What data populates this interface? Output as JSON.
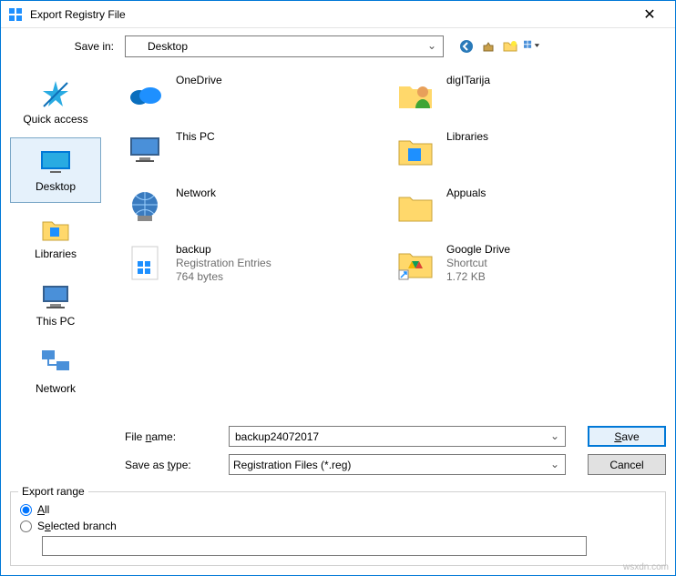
{
  "window": {
    "title": "Export Registry File",
    "save_in_label": "Save in:",
    "save_in_value": "Desktop"
  },
  "toolbar_icons": [
    "back-icon",
    "up-icon",
    "new-folder-icon",
    "view-menu-icon"
  ],
  "places": [
    {
      "key": "quick",
      "label": "Quick access",
      "selected": false
    },
    {
      "key": "desktop",
      "label": "Desktop",
      "selected": true
    },
    {
      "key": "libs",
      "label": "Libraries",
      "selected": false
    },
    {
      "key": "thispc",
      "label": "This PC",
      "selected": false
    },
    {
      "key": "network",
      "label": "Network",
      "selected": false
    }
  ],
  "items": [
    {
      "name": "OneDrive",
      "sub1": "",
      "sub2": ""
    },
    {
      "name": "digITarija",
      "sub1": "",
      "sub2": ""
    },
    {
      "name": "This PC",
      "sub1": "",
      "sub2": ""
    },
    {
      "name": "Libraries",
      "sub1": "",
      "sub2": ""
    },
    {
      "name": "Network",
      "sub1": "",
      "sub2": ""
    },
    {
      "name": "Appuals",
      "sub1": "",
      "sub2": ""
    },
    {
      "name": "backup",
      "sub1": "Registration Entries",
      "sub2": "764 bytes"
    },
    {
      "name": "Google Drive",
      "sub1": "Shortcut",
      "sub2": "1.72 KB"
    }
  ],
  "fields": {
    "filename_label": "File name:",
    "filename_value": "backup24072017",
    "type_label": "Save as type:",
    "type_value": "Registration Files (*.reg)"
  },
  "buttons": {
    "save": "Save",
    "cancel": "Cancel"
  },
  "export_range": {
    "legend": "Export range",
    "all": "All",
    "selected_branch": "Selected branch",
    "branch_value": "",
    "choice": "all"
  },
  "attribution": "wsxdn.com"
}
